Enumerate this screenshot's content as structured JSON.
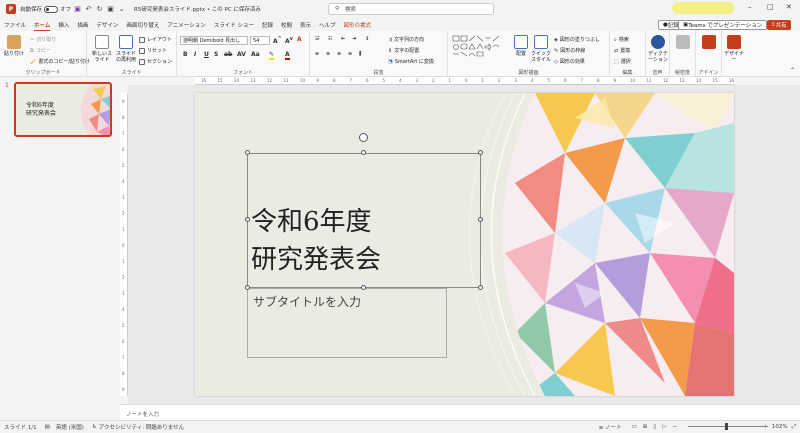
{
  "titlebar": {
    "autosave_label": "自動保存",
    "autosave_state": "オフ",
    "filename": "R5研究発表会スライド.pptx • この PC に保存済み",
    "search_placeholder": "検索"
  },
  "menu": {
    "items": [
      "ファイル",
      "ホーム",
      "挿入",
      "描画",
      "デザイン",
      "画面切り替え",
      "アニメーション",
      "スライド ショー",
      "記録",
      "校閲",
      "表示",
      "ヘルプ",
      "図形の書式"
    ],
    "active": "ホーム",
    "record_label": "記録",
    "teams_label": "Teams でプレゼンテーション",
    "share_label": "共有"
  },
  "ribbon": {
    "paste": "貼り付け",
    "cut": "切り取り",
    "copy": "コピー",
    "format_painter": "書式のコピー/貼り付け",
    "clipboard": "クリップボード",
    "new_slide": "新しいスライド",
    "reuse_slide": "スライドの再利用",
    "layout": "レイアウト",
    "reset": "リセット",
    "section": "セクション",
    "slides_group": "スライド",
    "font_name": "游明朝 Demibold 見出し",
    "font_size": "54",
    "font_group": "フォント",
    "text_direction": "文字列の方向",
    "align_text": "文字の配置",
    "smartart": "SmartArt に変換",
    "paragraph_group": "段落",
    "arrange": "配置",
    "quick_styles": "クイックスタイル",
    "shape_fill": "図形の塗りつぶし",
    "shape_outline": "図形の枠線",
    "shape_effects": "図形の効果",
    "drawing_group": "図形描画",
    "find": "検索",
    "replace": "置換",
    "select": "選択",
    "editing_group": "編集",
    "dictate": "ディクテーション",
    "voice_group": "音声",
    "sensitivity": "秘密度",
    "addins": "アドイン",
    "designer": "デザイナー"
  },
  "slide": {
    "title_line1": "令和6年度",
    "title_line2": "研究発表会",
    "subtitle": "サブタイトルを入力"
  },
  "thumbnail": {
    "number": "1",
    "title": "令和6年度\n研究発表会"
  },
  "notes": {
    "placeholder": "ノートを入力"
  },
  "status": {
    "slide": "スライド 1/1",
    "language": "英語 (米国)",
    "accessibility": "アクセシビリティ: 問題ありません",
    "notes": "ノート",
    "zoom": "102%"
  },
  "colors": {
    "accent": "#c43e1c",
    "slide_bg": "#ecebe3"
  }
}
